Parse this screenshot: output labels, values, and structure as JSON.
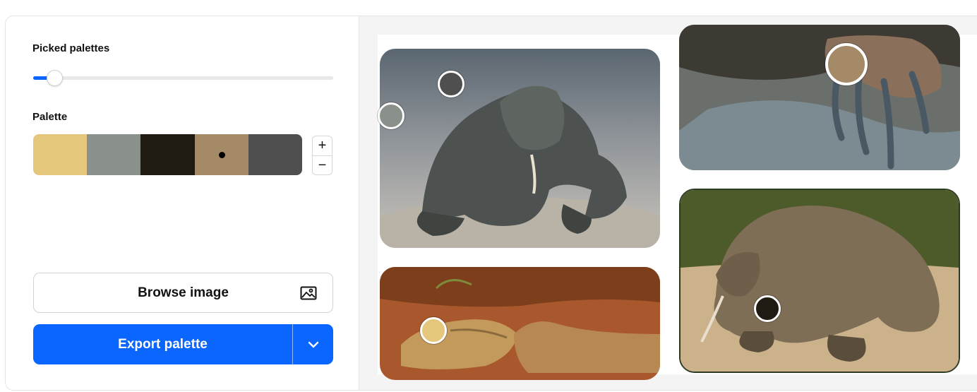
{
  "left_panel": {
    "picked_label": "Picked palettes",
    "slider": {
      "value_fraction": 0.07
    },
    "palette_label": "Palette",
    "swatches": [
      "#e4c77d",
      "#8a918a",
      "#1f1b12",
      "#a58a68",
      "#4f4f4f"
    ],
    "selected_swatch_index": 3,
    "stepper": {
      "plus": "+",
      "minus": "−"
    },
    "browse_label": "Browse image",
    "browse_icon": "image-icon",
    "export_label": "Export palette",
    "export_caret_icon": "chevron-down-icon"
  },
  "colors": {
    "accent": "#0a66ff",
    "panel_bg": "#f4f4f5"
  },
  "image": {
    "description_icons": [
      "komodo-photo-1",
      "komodo-photo-2",
      "komodo-photo-3",
      "komodo-photo-4"
    ]
  }
}
